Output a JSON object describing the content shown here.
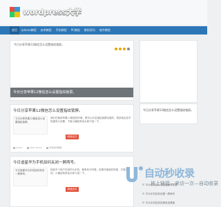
{
  "header": {
    "logo_text": "wordpress大学",
    "logo_colors": [
      "#e84c3d",
      "#3498db",
      "#2ecc71",
      "#f1c40f"
    ]
  },
  "nav": {
    "items": [
      "首页",
      "iphone教程",
      "安卓教程",
      "手机教程",
      "PC教程",
      "数码资讯",
      "软件教程"
    ]
  },
  "hero": {
    "title": "今日分享苹果12微信怎么设置指纹锁屏。",
    "caption": "今日分享苹果12微信怎么设置指纹锁屏。"
  },
  "side_top": {},
  "posts": [
    {
      "title": "今日分享苹果12微信怎么设置指纹锁屏。",
      "img_alt": "今日分享苹果12微信怎么设置指纹锁屏。",
      "excerpt_line1": "我们在使用苹果12微信的时候，",
      "excerpt_line2": "是可以开启指纹锁屏功能的，很多朋友还不",
      "excerpt_line3": "知道怎么设置，下面小编就来给大家介绍一下。",
      "read_more": "阅读全文",
      "meta_author": "admin",
      "meta_date": "2021-05-15",
      "meta_category": "手机软件教程"
    },
    {
      "title": "今日追星华为手机如何关闭一屏两号。",
      "img_alt": "今日追星华为手机如何关闭一屏两号。",
      "excerpt_line1": "相信不少用户在用华为手机，都有双卡",
      "excerpt_line2": "时候。但是在使用的时候，",
      "excerpt_line3": "才能关闭，小编这就来给大家介绍一下。",
      "read_more": "阅读全文"
    }
  ],
  "side_mid": {
    "title": "今日分享苹果12微信怎么设置指纹锁屏。"
  },
  "watermark": {
    "big": "自动秒收录",
    "small": "放上链接—来访一次—自动收录"
  },
  "side_list": [
    "华为手机怎么关闭运营商信息",
    "华为手机如何设置一屏两号",
    "华为手机如何查看电池健康"
  ]
}
